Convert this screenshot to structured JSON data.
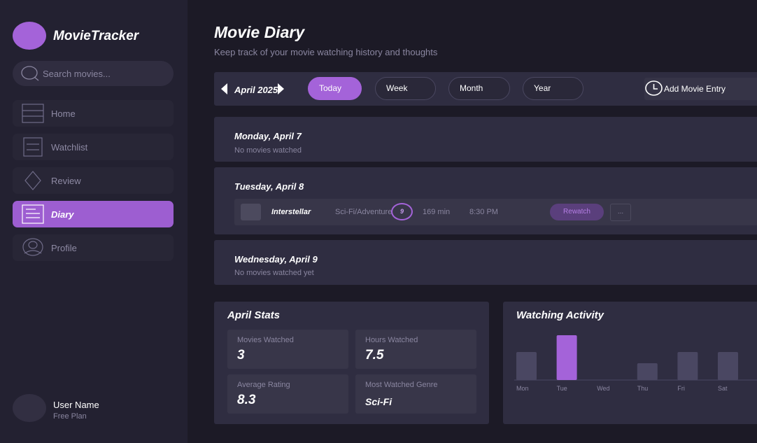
{
  "app": {
    "name": "MovieTracker"
  },
  "search": {
    "placeholder": "Search movies..."
  },
  "sidebar": {
    "items": [
      {
        "label": "Home",
        "icon": "home-icon"
      },
      {
        "label": "Watchlist",
        "icon": "list-icon"
      },
      {
        "label": "Review",
        "icon": "diamond-icon"
      },
      {
        "label": "Diary",
        "icon": "diary-icon",
        "active": true
      },
      {
        "label": "Profile",
        "icon": "profile-icon"
      }
    ]
  },
  "user": {
    "name": "User Name",
    "plan": "Free Plan"
  },
  "header": {
    "title": "Movie Diary",
    "subtitle": "Keep track of your movie watching history and thoughts"
  },
  "toolbar": {
    "month": "April 2025",
    "filters": [
      "Today",
      "Week",
      "Month",
      "Year"
    ],
    "active_filter": "Today",
    "add_entry": "Add Movie Entry"
  },
  "diary": {
    "days": [
      {
        "title": "Monday, April 7",
        "empty_text": "No movies watched"
      },
      {
        "title": "Tuesday, April 8",
        "entry": {
          "title": "Interstellar",
          "genre": "Sci-Fi/Adventure",
          "rating": "9",
          "runtime": "169 min",
          "time": "8:30 PM",
          "tag": "Rewatch",
          "more": "..."
        }
      },
      {
        "title": "Wednesday, April 9",
        "empty_text": "No movies watched yet"
      }
    ]
  },
  "stats": {
    "title": "April Stats",
    "items": [
      {
        "label": "Movies Watched",
        "value": "3"
      },
      {
        "label": "Hours Watched",
        "value": "7.5"
      },
      {
        "label": "Average Rating",
        "value": "8.3"
      },
      {
        "label": "Most Watched Genre",
        "value": "Sci-Fi"
      }
    ]
  },
  "activity": {
    "title": "Watching Activity"
  },
  "chart_data": {
    "type": "bar",
    "categories": [
      "Mon",
      "Tue",
      "Wed",
      "Thu",
      "Fri",
      "Sat"
    ],
    "values": [
      2.5,
      4,
      0,
      1.5,
      2.5,
      2.5
    ],
    "highlight": "Tue",
    "colors": {
      "bar": "#4a4762",
      "highlight": "#a463d9"
    }
  },
  "colors": {
    "accent": "#a463d9",
    "background": "#1c1a26",
    "sidebar": "#232131",
    "card": "#2f2d41"
  }
}
